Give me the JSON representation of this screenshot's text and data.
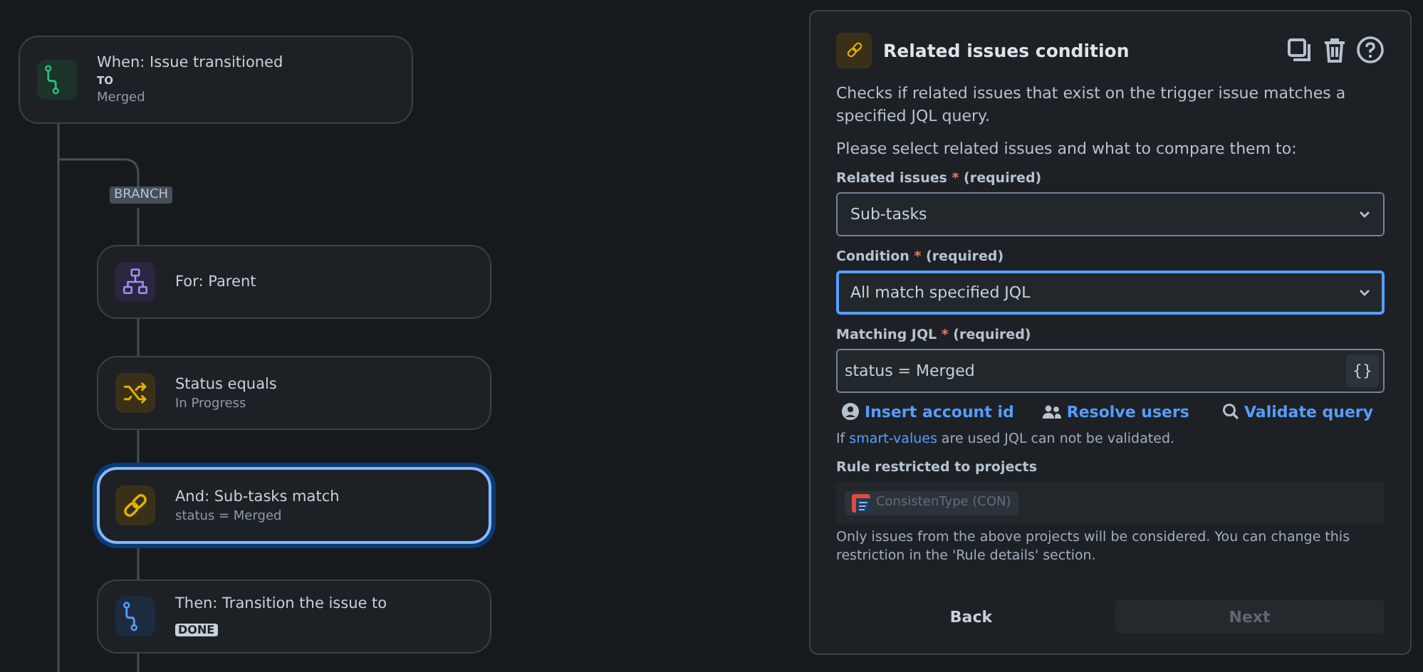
{
  "trigger": {
    "title": "When: Issue transitioned",
    "label": "TO",
    "value": "Merged"
  },
  "branch": {
    "label": "BRANCH"
  },
  "steps": [
    {
      "kind": "branch",
      "title": "For: Parent",
      "selected": false
    },
    {
      "kind": "condition",
      "title": "Status equals",
      "subtitle": "In Progress",
      "selected": false
    },
    {
      "kind": "related",
      "title": "And: Sub-tasks match",
      "subtitle": "status = Merged",
      "selected": true
    },
    {
      "kind": "action",
      "title": "Then: Transition the issue to",
      "lozenge": "DONE",
      "selected": false
    }
  ],
  "panel": {
    "title": "Related issues condition",
    "description": "Checks if related issues that exist on the trigger issue matches a specified JQL query.",
    "prompt": "Please select related issues and what to compare them to:",
    "fields": [
      {
        "kind": "select",
        "label": "Related issues",
        "mark": "*",
        "hint": "(required)",
        "value": "Sub-tasks",
        "focused": false
      },
      {
        "kind": "select",
        "label": "Condition",
        "mark": "*",
        "hint": "(required)",
        "value": "All match specified JQL",
        "focused": true
      },
      {
        "kind": "code",
        "label": "Matching JQL",
        "mark": "*",
        "hint": "(required)",
        "value": "status = Merged",
        "button": "{}",
        "focused": false
      }
    ],
    "links": [
      {
        "kind": "account",
        "text": "Insert account id"
      },
      {
        "kind": "users",
        "text": "Resolve users"
      },
      {
        "kind": "search",
        "text": "Validate query"
      }
    ],
    "note": {
      "before": "If",
      "link": "smart-values",
      "after": "are used JQL can not be validated."
    },
    "projects": {
      "label": "Rule restricted to projects",
      "chip": "ConsistenType (CON)",
      "help": "Only issues from the above projects will be considered. You can change this restriction in the 'Rule details' section."
    },
    "buttons": [
      {
        "label": "Back",
        "disabled": false
      },
      {
        "label": "Next",
        "disabled": true
      }
    ]
  }
}
